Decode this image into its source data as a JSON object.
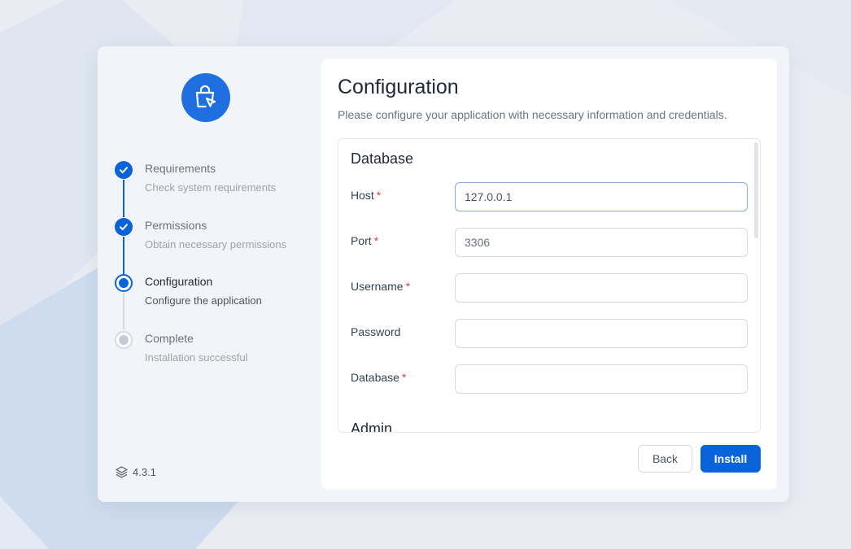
{
  "colors": {
    "accent": "#0a63d8",
    "page_bg": "#e9edf3",
    "card_bg": "#f1f4f9",
    "required": "#e53e3e",
    "pending": "#c4cad4"
  },
  "logo": {
    "icon": "shopping-bag-cursor-icon"
  },
  "steps": [
    {
      "title": "Requirements",
      "desc": "Check system requirements",
      "state": "done"
    },
    {
      "title": "Permissions",
      "desc": "Obtain necessary permissions",
      "state": "done"
    },
    {
      "title": "Configuration",
      "desc": "Configure the application",
      "state": "active"
    },
    {
      "title": "Complete",
      "desc": "Installation successful",
      "state": "pending"
    }
  ],
  "version": {
    "icon": "layers-icon",
    "label": "4.3.1"
  },
  "panel": {
    "title": "Configuration",
    "subtitle": "Please configure your application with necessary information and credentials."
  },
  "database": {
    "section_title": "Database",
    "fields": [
      {
        "label": "Host",
        "required": "*",
        "value": "127.0.0.1",
        "placeholder": ""
      },
      {
        "label": "Port",
        "required": "*",
        "value": "",
        "placeholder": "3306"
      },
      {
        "label": "Username",
        "required": "*",
        "value": "",
        "placeholder": ""
      },
      {
        "label": "Password",
        "required": "",
        "value": "",
        "placeholder": ""
      },
      {
        "label": "Database",
        "required": "*",
        "value": "",
        "placeholder": ""
      }
    ]
  },
  "admin": {
    "section_title": "Admin"
  },
  "buttons": {
    "back": "Back",
    "install": "Install"
  }
}
